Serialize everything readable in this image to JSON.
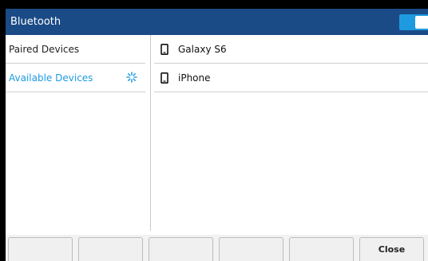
{
  "title_bar": {
    "title": "Bluetooth",
    "toggle_on": true,
    "accent_color": "#1e9be0",
    "bar_color": "#1b4b86"
  },
  "left_menu": {
    "items": [
      {
        "label": "Paired Devices",
        "active": false
      },
      {
        "label": "Available Devices",
        "active": true,
        "icon": "spinner-icon"
      }
    ]
  },
  "devices": [
    {
      "label": "Galaxy S6",
      "icon": "phone-icon"
    },
    {
      "label": "iPhone",
      "icon": "phone-icon"
    }
  ],
  "softkeys": [
    "",
    "",
    "",
    "",
    "",
    "Close"
  ]
}
